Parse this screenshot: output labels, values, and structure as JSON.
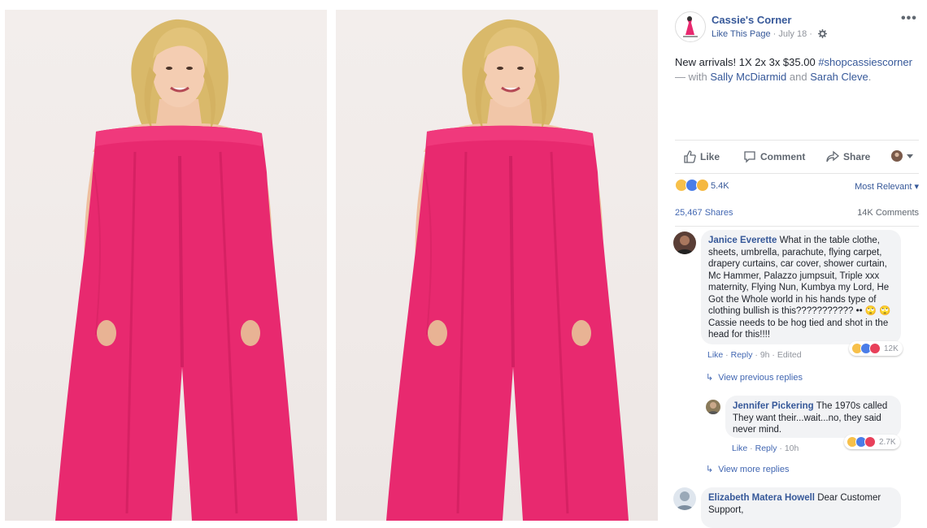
{
  "page": {
    "name": "Cassie's Corner",
    "like_label": "Like This Page",
    "separator": "·",
    "date": "July 18",
    "settings_icon": "gear-icon",
    "more_label": "•••"
  },
  "post": {
    "text": "New arrivals! 1X 2x 3x $35.00",
    "hashtag": "#shopcassiescorner",
    "with_label": "— with",
    "tag1": "Sally McDiarmid",
    "and_label": "and",
    "tag2": "Sarah Cleve",
    "end": "."
  },
  "actions": {
    "like": "Like",
    "comment": "Comment",
    "share": "Share"
  },
  "stats": {
    "reaction_count": "5.4K",
    "sort_label": "Most Relevant ▾",
    "shares": "25,467 Shares",
    "comments": "14K Comments"
  },
  "comments": [
    {
      "author": "Janice Everette",
      "text": "What in the table clothe, sheets, umbrella, parachute, flying carpet, drapery curtains, car cover, shower curtain, Mc Hammer, Palazzo jumpsuit, Triple xxx maternity, Flying Nun, Kumbya my Lord, He Got the Whole world in his hands type of clothing bullish is this??????????? •• 🙄 🙄 Cassie needs to be hog tied and shot in the head for this!!!!",
      "like": "Like",
      "reply": "Reply",
      "time": "9h",
      "edited": "Edited",
      "reaction_count": "12K",
      "view_replies": "View previous replies"
    },
    {
      "author": "Jennifer Pickering",
      "text": "The 1970s called They want their...wait...no, they said never mind.",
      "like": "Like",
      "reply": "Reply",
      "time": "10h",
      "reaction_count": "2.7K",
      "view_replies": "View more replies"
    },
    {
      "author": "Elizabeth Matera Howell",
      "text": "Dear Customer Support,"
    }
  ],
  "colors": {
    "link": "#365899",
    "garment": "#e8296f",
    "backdrop": "#f0eae8"
  }
}
